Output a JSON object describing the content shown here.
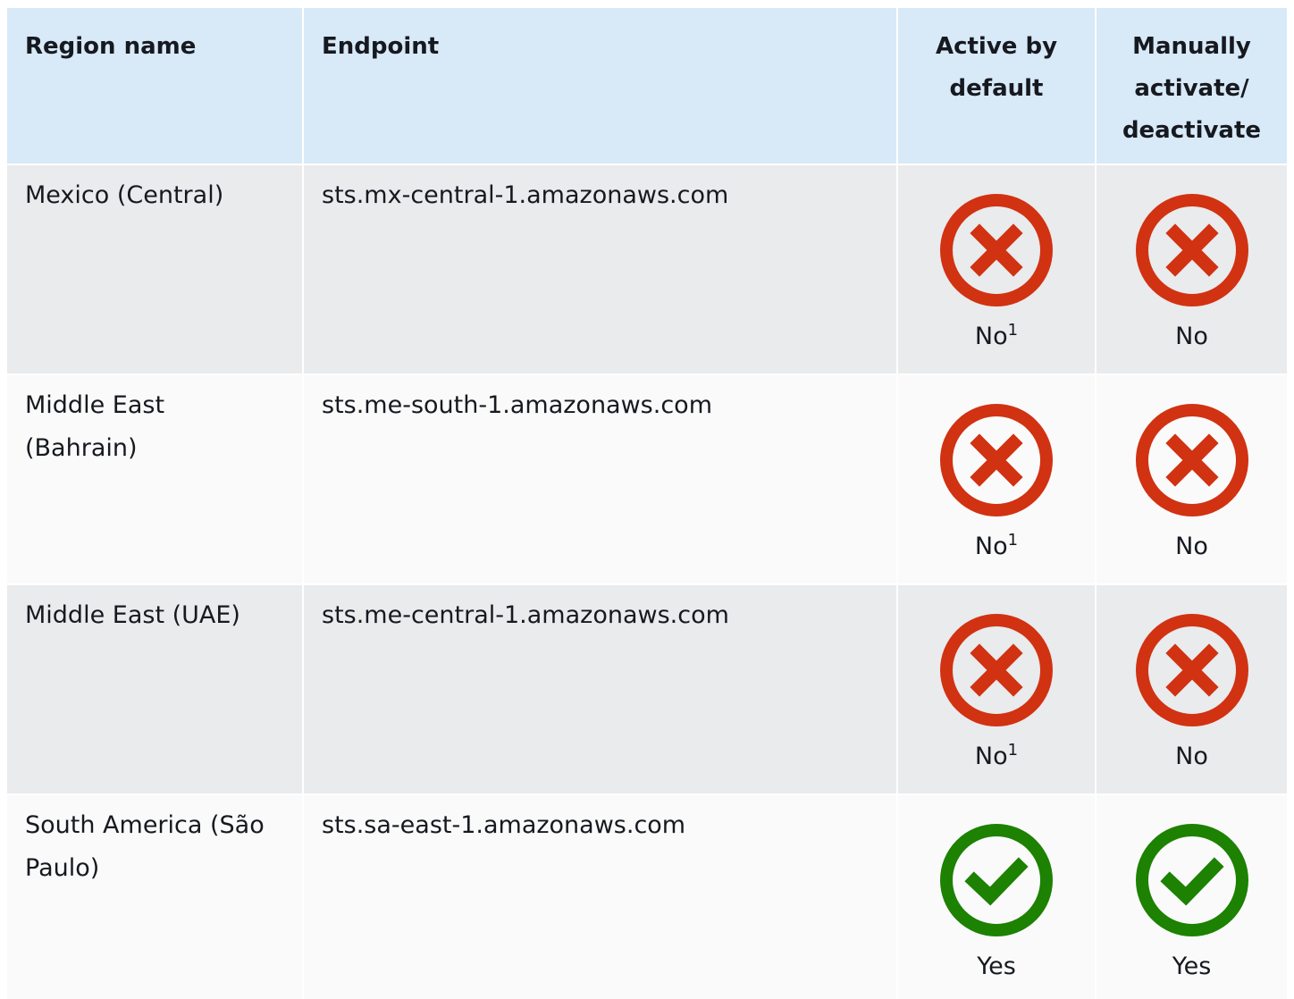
{
  "table": {
    "headers": {
      "region": "Region name",
      "endpoint": "Endpoint",
      "active_line1": "Active by",
      "active_line2": "default",
      "manual_line1": "Manually",
      "manual_line2": "activate/",
      "manual_line3": "deactivate"
    },
    "rows": [
      {
        "region": "Mexico (Central)",
        "endpoint": "sts.mx-central-1.amazonaws.com",
        "active": {
          "icon": "x-circle-icon",
          "label": "No",
          "footnote": "1"
        },
        "manual": {
          "icon": "x-circle-icon",
          "label": "No"
        }
      },
      {
        "region": "Middle East (Bahrain)",
        "endpoint": "sts.me-south-1.amazonaws.com",
        "active": {
          "icon": "x-circle-icon",
          "label": "No",
          "footnote": "1"
        },
        "manual": {
          "icon": "x-circle-icon",
          "label": "No"
        }
      },
      {
        "region": "Middle East (UAE)",
        "endpoint": "sts.me-central-1.amazonaws.com",
        "active": {
          "icon": "x-circle-icon",
          "label": "No",
          "footnote": "1"
        },
        "manual": {
          "icon": "x-circle-icon",
          "label": "No"
        }
      },
      {
        "region": "South America (São Paulo)",
        "endpoint": "sts.sa-east-1.amazonaws.com",
        "active": {
          "icon": "check-circle-icon",
          "label": "Yes"
        },
        "manual": {
          "icon": "check-circle-icon",
          "label": "Yes"
        }
      }
    ]
  },
  "colors": {
    "header_bg": "#d8e9f8",
    "row_gray_bg": "#e9ebed",
    "row_light_bg": "#fafafa",
    "no_icon": "#d13212",
    "yes_icon": "#1d8102"
  }
}
